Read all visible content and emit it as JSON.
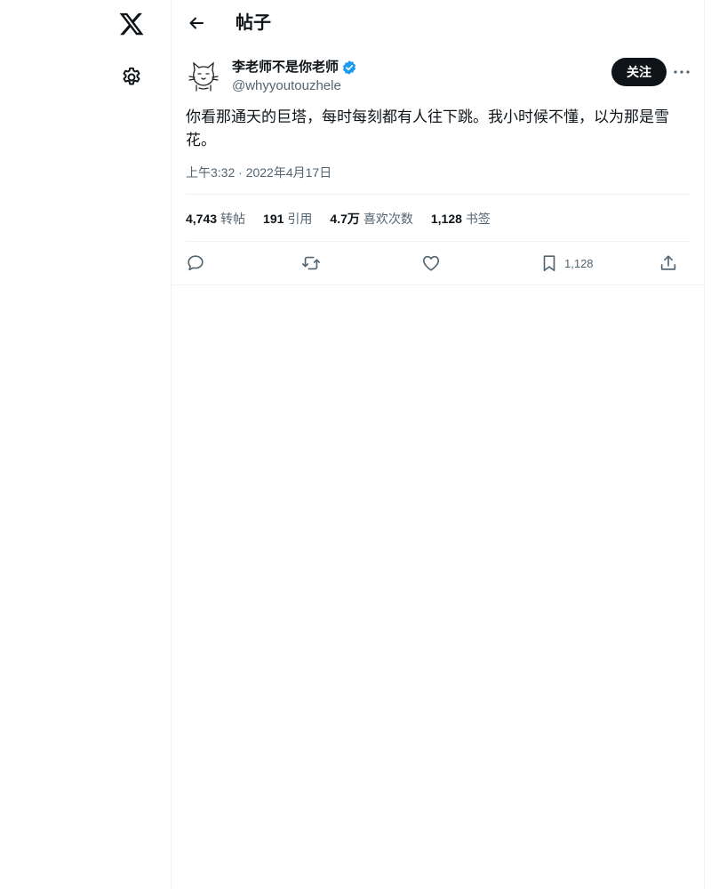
{
  "header": {
    "title": "帖子"
  },
  "author": {
    "display_name": "李老师不是你老师",
    "handle": "@whyyoutouzhele",
    "verified": true
  },
  "follow_label": "关注",
  "tweet": {
    "text": "你看那通天的巨塔，每时每刻都有人往下跳。我小时候不懂，以为那是雪花。",
    "timestamp": "上午3:32 · 2022年4月17日"
  },
  "stats": [
    {
      "value": "4,743",
      "label": "转帖"
    },
    {
      "value": "191",
      "label": "引用"
    },
    {
      "value": "4.7万",
      "label": "喜欢次数"
    },
    {
      "value": "1,128",
      "label": "书签"
    }
  ],
  "actions": {
    "bookmark_count": "1,128"
  },
  "colors": {
    "text": "#0f1419",
    "secondary": "#536471",
    "border": "#eff3f4",
    "verified": "#1d9bf0"
  },
  "icons": [
    "x-logo-icon",
    "settings-gear-icon",
    "back-arrow-icon",
    "verified-badge-icon",
    "more-icon",
    "reply-icon",
    "retweet-icon",
    "like-icon",
    "bookmark-icon",
    "share-icon"
  ]
}
